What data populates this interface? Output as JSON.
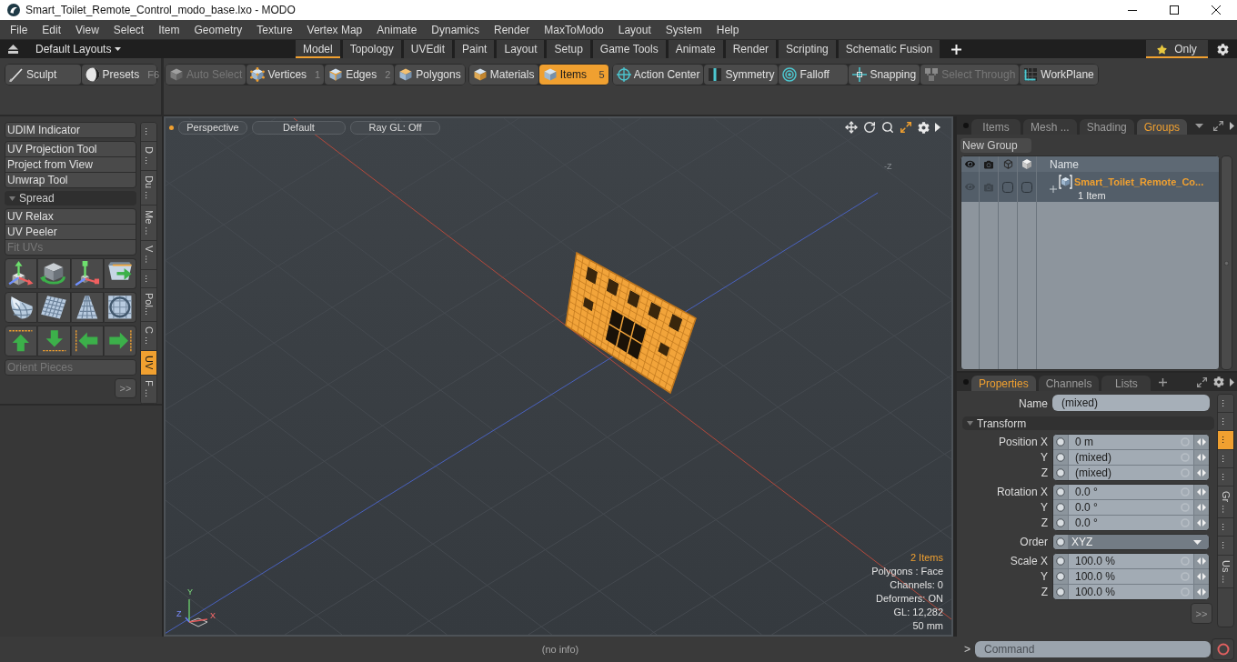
{
  "window": {
    "title": "Smart_Toilet_Remote_Control_modo_base.lxo - MODO"
  },
  "menu_bar": [
    "File",
    "Edit",
    "View",
    "Select",
    "Item",
    "Geometry",
    "Texture",
    "Vertex Map",
    "Animate",
    "Dynamics",
    "Render",
    "MaxToModo",
    "Layout",
    "System",
    "Help"
  ],
  "layout_bar": {
    "layouts_menu": "Default Layouts",
    "tabs": [
      {
        "label": "Model",
        "selected": true
      },
      {
        "label": "Topology",
        "selected": false
      },
      {
        "label": "UVEdit",
        "selected": false
      },
      {
        "label": "Paint",
        "selected": false
      },
      {
        "label": "Layout",
        "selected": false
      },
      {
        "label": "Setup",
        "selected": false
      },
      {
        "label": "Game Tools",
        "selected": false
      },
      {
        "label": "Animate",
        "selected": false
      },
      {
        "label": "Render",
        "selected": false
      },
      {
        "label": "Scripting",
        "selected": false
      },
      {
        "label": "Schematic Fusion",
        "selected": false
      }
    ],
    "only_toggle": {
      "label": "Only",
      "on": true
    }
  },
  "toolbar": {
    "groups": [
      [
        {
          "label": "Sculpt",
          "selected": false,
          "disabled": false
        },
        {
          "label": "Presets",
          "shortcut": "F6",
          "selected": false,
          "disabled": false
        }
      ],
      [
        {
          "label": "Auto Select",
          "selected": false,
          "disabled": true
        },
        {
          "label": "Vertices",
          "shortcut": "1",
          "selected": false,
          "disabled": false
        },
        {
          "label": "Edges",
          "shortcut": "2",
          "selected": false,
          "disabled": false
        },
        {
          "label": "Polygons",
          "selected": false,
          "disabled": false
        }
      ],
      [
        {
          "label": "Materials",
          "selected": false,
          "disabled": false
        },
        {
          "label": "Items",
          "shortcut": "5",
          "selected": true,
          "disabled": false
        }
      ],
      [
        {
          "label": "Action Center",
          "selected": false,
          "disabled": false
        },
        {
          "label": "Symmetry",
          "selected": false,
          "disabled": false
        },
        {
          "label": "Falloff",
          "selected": false,
          "disabled": false
        },
        {
          "label": "Snapping",
          "selected": false,
          "disabled": false
        },
        {
          "label": "Select Through",
          "selected": false,
          "disabled": true
        },
        {
          "label": "WorkPlane",
          "selected": false,
          "disabled": false
        }
      ]
    ]
  },
  "uv_panel": {
    "groups": [
      [
        {
          "label": "UDIM Indicator",
          "disabled": false
        }
      ],
      [
        {
          "label": "UV Projection Tool",
          "disabled": false
        },
        {
          "label": "Project from View",
          "disabled": false
        },
        {
          "label": "Unwrap Tool",
          "disabled": false
        }
      ]
    ],
    "spread": {
      "label": "Spread",
      "expanded": true,
      "items": [
        {
          "label": "UV Relax",
          "disabled": false
        },
        {
          "label": "UV Peeler",
          "disabled": false
        },
        {
          "label": "Fit UVs",
          "disabled": true
        }
      ],
      "orient_button": {
        "label": "Orient Pieces",
        "disabled": true
      }
    },
    "more_button": ">>",
    "side_tabs": [
      {
        "label": "...",
        "selected": false
      },
      {
        "label": "D ...",
        "selected": false
      },
      {
        "label": "Du ...",
        "selected": false
      },
      {
        "label": "Me ...",
        "selected": false
      },
      {
        "label": "V ...",
        "selected": false
      },
      {
        "label": "...",
        "selected": false
      },
      {
        "label": "Pol...",
        "selected": false
      },
      {
        "label": "C ...",
        "selected": false
      },
      {
        "label": "UV",
        "selected": true
      },
      {
        "label": "F ...",
        "selected": false
      }
    ]
  },
  "viewport": {
    "view_buttons": [
      "Perspective",
      "Default",
      "Ray GL: Off"
    ],
    "axis_label": "-Z",
    "selection_count": "2 Items",
    "stats": [
      "Polygons : Face",
      "Channels: 0",
      "Deformers: ON",
      "GL: 12,282",
      "50 mm"
    ],
    "gizmo_labels": [
      "Y",
      "Z",
      "X"
    ]
  },
  "groups_panel": {
    "tabs": [
      {
        "label": "Items",
        "selected": false
      },
      {
        "label": "Mesh ...",
        "selected": false
      },
      {
        "label": "Shading",
        "selected": false
      },
      {
        "label": "Groups",
        "selected": true
      }
    ],
    "new_group_button": "New Group",
    "name_column": "Name",
    "rows": [
      {
        "name": "Smart_Toilet_Remote_Co...",
        "count": "1 Item",
        "expanded": false,
        "checkboxes": [
          {
            "checked": false
          },
          {
            "checked": false
          }
        ]
      }
    ]
  },
  "properties_panel": {
    "tabs": [
      {
        "label": "Properties",
        "selected": true
      },
      {
        "label": "Channels",
        "selected": false
      },
      {
        "label": "Lists",
        "selected": false
      }
    ],
    "name_field": {
      "label": "Name",
      "value": "(mixed)"
    },
    "section": {
      "label": "Transform",
      "expanded": true
    },
    "field_groups": [
      {
        "kind": "numeric",
        "rows": [
          {
            "label": "Position X",
            "value": "0 m"
          },
          {
            "label": "Y",
            "value": "(mixed)"
          },
          {
            "label": "Z",
            "value": "(mixed)"
          }
        ]
      },
      {
        "kind": "numeric",
        "rows": [
          {
            "label": "Rotation X",
            "value": "0.0 °"
          },
          {
            "label": "Y",
            "value": "0.0 °"
          },
          {
            "label": "Z",
            "value": "0.0 °"
          }
        ]
      },
      {
        "kind": "dropdown",
        "rows": [
          {
            "label": "Order",
            "value": "XYZ"
          }
        ]
      },
      {
        "kind": "numeric",
        "rows": [
          {
            "label": "Scale X",
            "value": "100.0 %"
          },
          {
            "label": "Y",
            "value": "100.0 %"
          },
          {
            "label": "Z",
            "value": "100.0 %"
          }
        ]
      }
    ],
    "more_button": ">>",
    "side_tabs": [
      {
        "label": "...",
        "selected": false
      },
      {
        "label": "...",
        "selected": false
      },
      {
        "label": "...",
        "selected": true
      },
      {
        "label": "...",
        "selected": false
      },
      {
        "label": "...",
        "selected": false
      },
      {
        "label": "Gr ...",
        "selected": false
      },
      {
        "label": "...",
        "selected": false
      },
      {
        "label": "...",
        "selected": false
      },
      {
        "label": "Us ...",
        "selected": false
      }
    ]
  },
  "command_bar": {
    "prompt": ">",
    "placeholder": "Command"
  },
  "status_bar": {
    "message": "(no info)"
  }
}
